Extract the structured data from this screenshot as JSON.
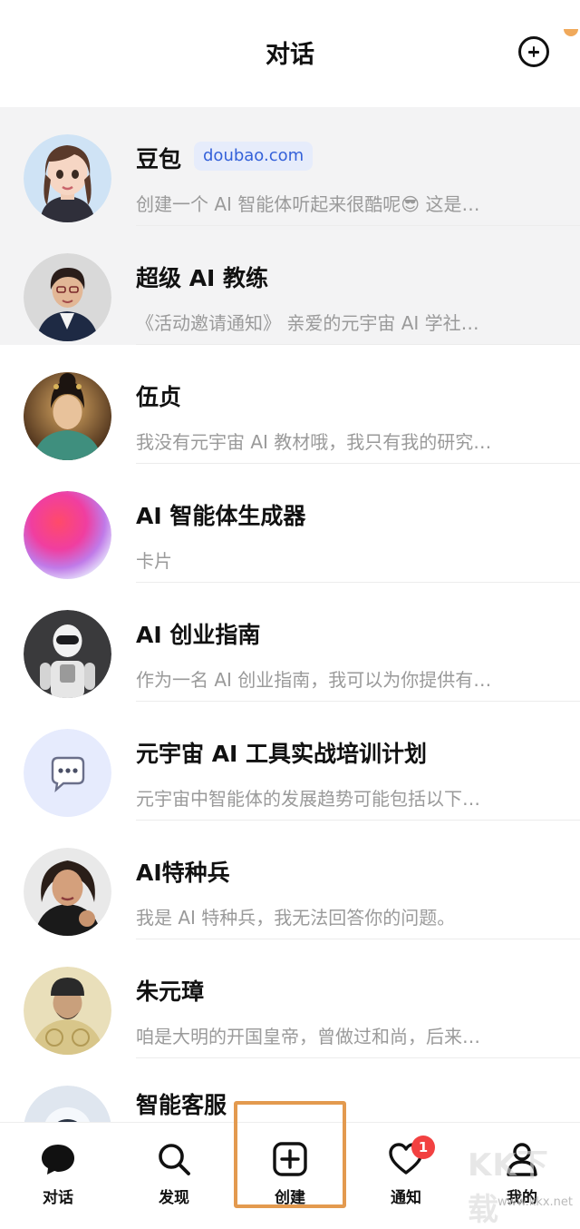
{
  "header": {
    "title": "对话"
  },
  "conversations": [
    {
      "name": "豆包",
      "badge": "doubao.com",
      "preview": "创建一个 AI 智能体听起来很酷呢😎 这是…",
      "pinned": true,
      "avatar": "woman-cartoon-avatar"
    },
    {
      "name": "超级 AI 教练",
      "preview": "《活动邀请通知》 亲爱的元宇宙 AI 学社…",
      "pinned": true,
      "avatar": "woman-photo-avatar"
    },
    {
      "name": "伍贞",
      "preview": "我没有元宇宙 AI 教材哦，我只有我的研究…",
      "pinned": false,
      "avatar": "ancient-woman-avatar"
    },
    {
      "name": "AI 智能体生成器",
      "preview": "卡片",
      "pinned": false,
      "avatar": "gradient-orb-avatar"
    },
    {
      "name": "AI 创业指南",
      "preview": "作为一名 AI 创业指南，我可以为你提供有…",
      "pinned": false,
      "avatar": "robot-avatar"
    },
    {
      "name": "元宇宙 AI 工具实战培训计划",
      "preview": "元宇宙中智能体的发展趋势可能包括以下…",
      "pinned": false,
      "avatar": "chat-bubble-avatar"
    },
    {
      "name": "AI特种兵",
      "preview": "我是 AI 特种兵，我无法回答你的问题。",
      "pinned": false,
      "avatar": "woman-fierce-avatar"
    },
    {
      "name": "朱元璋",
      "preview": "咱是大明的开国皇帝，曾做过和尚，后来…",
      "pinned": false,
      "avatar": "emperor-avatar"
    },
    {
      "name": "智能客服",
      "preview": "",
      "pinned": false,
      "avatar": "robot-head-avatar"
    }
  ],
  "tabbar": {
    "tabs": [
      {
        "label": "对话",
        "icon": "chat-bubble-icon"
      },
      {
        "label": "发现",
        "icon": "search-icon"
      },
      {
        "label": "创建",
        "icon": "plus-square-icon"
      },
      {
        "label": "通知",
        "icon": "heart-icon",
        "badge": "1"
      },
      {
        "label": "我的",
        "icon": "person-icon"
      }
    ]
  },
  "watermark": {
    "big": "KK下载",
    "small": "www.kkx.net"
  },
  "colors": {
    "accent_blue": "#3461d9",
    "badge_red": "#f24141",
    "highlight_orange": "#e39a4f",
    "pinned_bg": "#f3f3f4"
  }
}
